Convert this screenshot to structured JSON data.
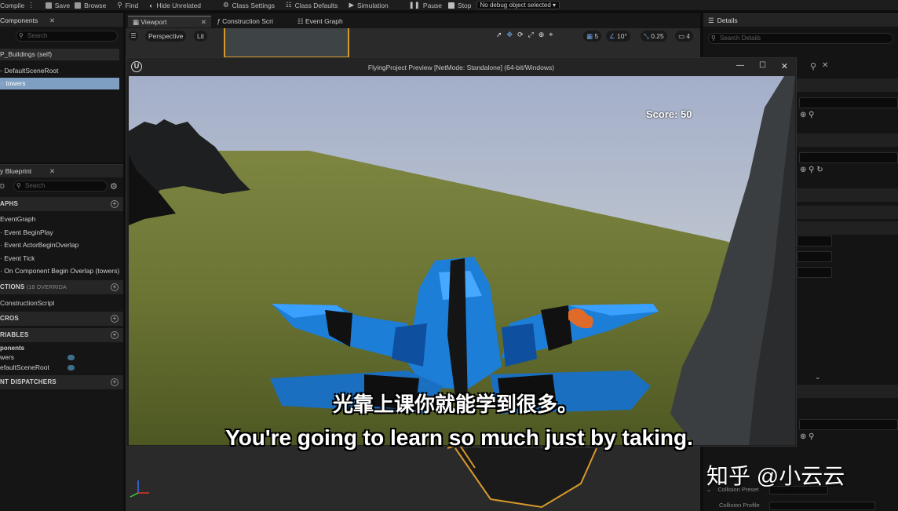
{
  "toolbar": {
    "compile": "Compile",
    "save": "Save",
    "browse": "Browse",
    "find": "Find",
    "hide_unrelated": "Hide Unrelated",
    "class_settings": "Class Settings",
    "class_defaults": "Class Defaults",
    "simulation": "Simulation",
    "pause": "Pause",
    "stop": "Stop",
    "debug_object": "No debug object selected"
  },
  "components_panel": {
    "title": "Components",
    "search_placeholder": "Search",
    "root": "P_Buildings (self)",
    "items": [
      "DefaultSceneRoot",
      "towers"
    ]
  },
  "blueprint_panel": {
    "title": "y Blueprint",
    "search_placeholder": "Search",
    "graphs_header": "APHS",
    "graphs": [
      "EventGraph",
      "Event BeginPlay",
      "Event ActorBeginOverlap",
      "Event Tick",
      "On Component Begin Overlap (towers)"
    ],
    "functions_header": "CTIONS",
    "functions_note": "(18 OVERRIDA",
    "functions": [
      "ConstructionScript"
    ],
    "macros_header": "CROS",
    "variables_header": "RIABLES",
    "variables_group": "ponents",
    "variables": [
      "wers",
      "efaultSceneRoot"
    ],
    "dispatchers_header": "NT DISPATCHERS"
  },
  "editor_tabs": [
    "Viewport",
    "Construction Scri",
    "Event Graph"
  ],
  "viewport_bar": {
    "perspective": "Perspective",
    "lit": "Lit",
    "grid": "5",
    "angle": "10°",
    "scale": "0.25",
    "camera": "4"
  },
  "details_panel": {
    "title": "Details",
    "search_placeholder": "Search Details",
    "collision_preset": "Collision Preset",
    "collision_profile": "Collision Profile"
  },
  "game_window": {
    "title": "FlyingProject Preview [NetMode: Standalone]  (64-bit/Windows)",
    "score": "Score: 50"
  },
  "subtitles": {
    "chinese": "光靠上课你就能学到很多。",
    "english": "You're going to learn so much just by taking."
  },
  "watermark": "知乎 @小云云"
}
